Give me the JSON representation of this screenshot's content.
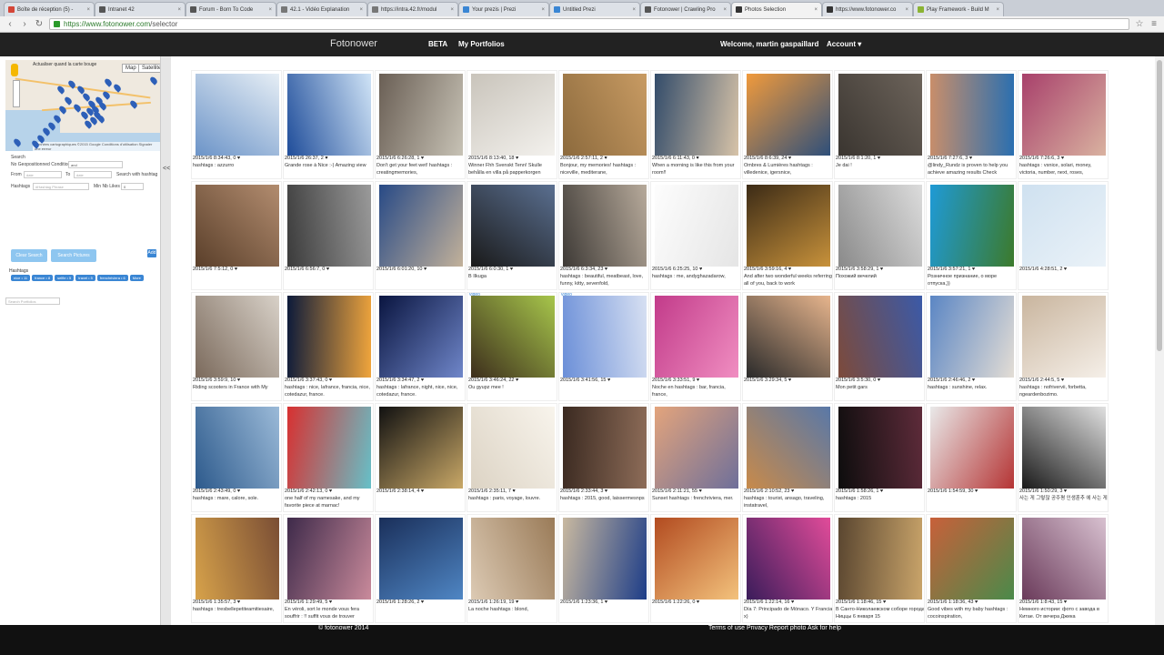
{
  "browser": {
    "tabs": [
      {
        "title": "Boîte de réception (5) -",
        "favicon_color": "#d44638"
      },
      {
        "title": "Intranet 42",
        "favicon_color": "#555555"
      },
      {
        "title": "Forum - Born To Code",
        "favicon_color": "#555555"
      },
      {
        "title": "42.1 - Vidéo Explanation",
        "favicon_color": "#777777"
      },
      {
        "title": "https://intra.42.fr/modul",
        "favicon_color": "#777777"
      },
      {
        "title": "Your prezis | Prezi",
        "favicon_color": "#3a86d4"
      },
      {
        "title": "Untitled Prezi",
        "favicon_color": "#3a86d4"
      },
      {
        "title": "Fotonower | Crawling Pro",
        "favicon_color": "#555555"
      },
      {
        "title": "Photos Selection",
        "favicon_color": "#333333",
        "active": true
      },
      {
        "title": "https://www.fotonower.co",
        "favicon_color": "#333333"
      },
      {
        "title": "Play Framework - Build M",
        "favicon_color": "#8bb333"
      }
    ],
    "url_host": "https://www.fotonower.com",
    "url_path": "/selector",
    "back_icon": "back-arrow-icon",
    "forward_icon": "forward-arrow-icon",
    "reload_icon": "reload-icon",
    "star_icon": "star-icon",
    "menu_icon": "hamburger-menu-icon"
  },
  "header": {
    "logo": "Fotonower",
    "beta": "BETA",
    "portfolios": "My Portfolios",
    "welcome": "Welcome, martin gaspaillard",
    "account": "Account ▾"
  },
  "sidebar": {
    "map": {
      "map_type": "Map",
      "satellite_type": "Satellite",
      "checkbox_label": "Actualiser quand la carte bouge",
      "attribution": "Données cartographiques ©2015 Google  Conditions d'utilisation  Signaler une erreur",
      "colors": {
        "water": "#b7d3ea",
        "land": "#efe9df",
        "pin": "#2d5fb8"
      }
    },
    "search_label": "Search",
    "no_geo_label": "No Geopositionned Condition",
    "no_geo_value": "and",
    "from_label": "From",
    "from_placeholder": "date",
    "to_label": "To",
    "to_placeholder": "date",
    "search_hashtag_label": "Search with hashtag",
    "hashtags_label": "Hashtags",
    "hashtags_placeholder": "#Hashtag Phrase",
    "min_likes_label": "Min Nb Likes",
    "min_likes_value": "0",
    "clear_button": "Clear Search",
    "search_button": "Search Pictures",
    "add_button": "Add",
    "hashtag_section_title": "Hashtags",
    "hashtags": [
      "nice • 11",
      "france • 8",
      "selfie • 5",
      "travel • 5",
      "frenchriviera • 6",
      "More"
    ],
    "portfolio_placeholder": "Search Portfolios",
    "collapse_label": "<<"
  },
  "photos": [
    {
      "meta": "2015/1/6 8:34:43, 0 ♥",
      "caption": "hashtags : azzurro",
      "colors": [
        "#6c94c8",
        "#e6eef5"
      ]
    },
    {
      "meta": "2015/1/6 26:37, 2 ♥",
      "caption": "Grande rose à Nice :-) Amazing view",
      "colors": [
        "#1f4d9a",
        "#cfe3f6"
      ]
    },
    {
      "meta": "2015/1/6 6:26:28, 1 ♥",
      "caption": "Don't get your feet wet! hashtags : creatingmemories,",
      "colors": [
        "#6a5f55",
        "#c7c2b5"
      ]
    },
    {
      "meta": "2015/1/6 8:13:40, 18 ♥",
      "caption": "Winner Fhh Svenskt Tenn! Skulle behålla en villa på papperkorgen",
      "colors": [
        "#c9c4bb",
        "#f3f1ed"
      ]
    },
    {
      "meta": "2015/1/6 2:57:11, 2 ♥",
      "caption": "Bonjour, my memories! hashtags : niceville, mediterane,",
      "colors": [
        "#8c6a3d",
        "#c89b63"
      ]
    },
    {
      "meta": "2015/1/6 6:11:43, 0 ♥",
      "caption": "When a morning is like this from your room!!",
      "colors": [
        "#334c6a",
        "#d7c3a8"
      ]
    },
    {
      "meta": "2015/1/6 8:6:39, 24 ♥",
      "caption": "Ombres & Lumières hashtags : villedenice, igersnice,",
      "colors": [
        "#f09a3c",
        "#2e4f7a"
      ]
    },
    {
      "meta": "2015/1/6 8:1:20, 1 ♥",
      "caption": "Je dai !",
      "colors": [
        "#3a3530",
        "#6d645b"
      ]
    },
    {
      "meta": "2015/1/6 7:27:6, 3 ♥",
      "caption": "@lindy_Rundz is proven to help you achieve amazing results Check",
      "colors": [
        "#c98e6a",
        "#2a6fb0"
      ]
    },
    {
      "meta": "2015/1/6 7:26:6, 3 ♥",
      "caption": "hashtags : vsnice, solari, money, victoria, number, next, roses,",
      "colors": [
        "#a8406b",
        "#d9b2a0"
      ]
    },
    {
      "meta": "2015/1/6 7:5:12, 0 ♥",
      "caption": "",
      "colors": [
        "#5a3f2a",
        "#b28c6f"
      ]
    },
    {
      "meta": "2015/1/6 6:56:7, 0 ♥",
      "caption": "",
      "colors": [
        "#3b3b3b",
        "#9a9a9a"
      ]
    },
    {
      "meta": "2015/1/6 6:01:20, 10 ♥",
      "caption": "",
      "colors": [
        "#284a86",
        "#c2b19a"
      ]
    },
    {
      "meta": "2015/1/6 6:0:30, 1 ♥",
      "caption": "B Ilkuga",
      "colors": [
        "#1a1a1a",
        "#5a6f90"
      ]
    },
    {
      "meta": "2015/1/6 6:3:34, 23 ♥",
      "caption": "hashtags : beautiful, meatbeast, love, funny, kitty, sevenfold,",
      "colors": [
        "#3e3a36",
        "#b7aa9b"
      ]
    },
    {
      "meta": "2015/1/6 6:25:25, 10 ♥",
      "caption": "hashtags : me, andyghazadarow,",
      "colors": [
        "#fdfdfd",
        "#e5e5e5"
      ]
    },
    {
      "meta": "2015/1/6 3:59:16, 4 ♥",
      "caption": "And after two wonderful weeks referring all of you, back to work",
      "colors": [
        "#3c2b16",
        "#c8923b"
      ]
    },
    {
      "meta": "2015/1/6 3:58:29, 1 ♥",
      "caption": "Похожий вечелий",
      "colors": [
        "#8a8a8a",
        "#dcdcdc"
      ]
    },
    {
      "meta": "2015/1/6 3:57:21, 1 ♥",
      "caption": "Розничное признание, о море отпуска,))",
      "colors": [
        "#1f9ad6",
        "#3c7a2b"
      ]
    },
    {
      "meta": "2015/1/6 4:28:51, 2 ♥",
      "caption": "",
      "colors": [
        "#cfe1f0",
        "#eaf2f8"
      ]
    },
    {
      "meta": "2015/1/6 3:59:9, 10 ♥",
      "caption": "Riding scooters in France with My",
      "colors": [
        "#7b6a5c",
        "#d8d1c8"
      ]
    },
    {
      "meta": "2015/1/6 3:37:43, 0 ♥",
      "caption": "hashtags : nice, lafrance, francia, nice, cotedazur, france.",
      "colors": [
        "#0c1a3a",
        "#f0a53c"
      ]
    },
    {
      "meta": "2015/1/6 3:34:47, 2 ♥",
      "caption": "hashtags : lafrance, night, nice, nice, cotedazur, france.",
      "colors": [
        "#0a1540",
        "#6f86c9"
      ]
    },
    {
      "meta": "2015/1/6 3:46:24, 22 ♥",
      "caption": "Ou gyupz mee !",
      "colors": [
        "#3d2e1c",
        "#a7c64b"
      ],
      "video": "video"
    },
    {
      "meta": "2015/1/6 3:41:56, 15 ♥",
      "caption": "",
      "colors": [
        "#6b8fd8",
        "#d7e0f2"
      ],
      "video": "video"
    },
    {
      "meta": "2015/1/6 3:33:51, 9 ♥",
      "caption": "Noche en hashtags : bar, francia, france,",
      "colors": [
        "#c23b8a",
        "#f08ec1"
      ]
    },
    {
      "meta": "2015/1/6 3:29:34, 5 ♥",
      "caption": "",
      "colors": [
        "#2a2a2a",
        "#e7b58d"
      ]
    },
    {
      "meta": "2015/1/6 3:5:30, 0 ♥",
      "caption": "Mon petit gars",
      "colors": [
        "#7d4a3a",
        "#3b5aa8"
      ]
    },
    {
      "meta": "2015/1/6 2:46:46, 2 ♥",
      "caption": "hashtags : sunshine, relax.",
      "colors": [
        "#5b86c4",
        "#e3ddd5"
      ]
    },
    {
      "meta": "2015/1/6 2:44:5, 5 ♥",
      "caption": "hashtags : nofrivervii, forbetta, ngeardenbozimo.",
      "colors": [
        "#c9b59e",
        "#f5efe8"
      ]
    },
    {
      "meta": "2015/1/6 2:43:49, 0 ♥",
      "caption": "hashtags : mare, calore, sole.",
      "colors": [
        "#2d5a8c",
        "#9bbad8"
      ]
    },
    {
      "meta": "2015/1/6 2:42:13, 0 ♥",
      "caption": "one half of my namesake, and my favorite piece at marnac!",
      "colors": [
        "#d83030",
        "#66c0c8"
      ]
    },
    {
      "meta": "2015/1/6 2:38:14, 4 ♥",
      "caption": "",
      "colors": [
        "#111111",
        "#c9a867"
      ]
    },
    {
      "meta": "2015/1/6 2:35:11, 7 ♥",
      "caption": "hashtags : paris, voyage, louvre.",
      "colors": [
        "#dcd3c4",
        "#f8f4ec"
      ]
    },
    {
      "meta": "2015/1/6 2:33:44, 3 ♥",
      "caption": "hashtags : 2015, good, laissermesnps",
      "colors": [
        "#3b2a21",
        "#8d6c58"
      ]
    },
    {
      "meta": "2015/1/6 2:11:21, 55 ♥",
      "caption": "Sunset hashtags : frenchriviera, mer.",
      "colors": [
        "#e3a47c",
        "#6e6f9a"
      ]
    },
    {
      "meta": "2015/1/6 2:10:52, 23 ♥",
      "caption": "hashtags : tourist, ansago, traveling, instatravel,",
      "colors": [
        "#c88a4a",
        "#5978a8"
      ]
    },
    {
      "meta": "2015/1/6 1:58:26, 1 ♥",
      "caption": "hashtags : 2015",
      "colors": [
        "#0d0d0d",
        "#5e2b3a"
      ]
    },
    {
      "meta": "2015/1/6 1:54:59, 30 ♥",
      "caption": "",
      "colors": [
        "#e9e9e9",
        "#b53434"
      ]
    },
    {
      "meta": "2015/1/6 1:50:29, 3 ♥",
      "caption": "사는 게 그렇잖 공주평 인생훈추 에 사는 게",
      "colors": [
        "#1a1a1a",
        "#e0e0e0"
      ]
    },
    {
      "meta": "2015/1/6 1:35:57, 3 ♥",
      "caption": "hashtags : tresbellepetiteamitiesaire,",
      "colors": [
        "#d7a24a",
        "#7a4e35"
      ]
    },
    {
      "meta": "2015/1/6 1:29:49, 5 ♥",
      "caption": "En véroli, sort le monde vous fera souffrir : !! suffit vous de trouver",
      "colors": [
        "#3e2a4a",
        "#c98a9b"
      ]
    },
    {
      "meta": "2015/1/6 1:28:26, 2 ♥",
      "caption": "",
      "colors": [
        "#1a2f5a",
        "#4f86c4"
      ]
    },
    {
      "meta": "2015/1/6 1:26:19, 19 ♥",
      "caption": "La noche hashtags : blond,",
      "colors": [
        "#dccab4",
        "#9a7b58"
      ]
    },
    {
      "meta": "2015/1/6 1:23:36, 1 ♥",
      "caption": "",
      "colors": [
        "#c9b9a0",
        "#1d3d88"
      ]
    },
    {
      "meta": "2015/1/6 1:22:26, 0 ♥",
      "caption": "",
      "colors": [
        "#b24b20",
        "#f3c27c"
      ]
    },
    {
      "meta": "2015/1/6 1:22:14, 16 ♥",
      "caption": "Día 7: Principado de Mónaco. Y Francia x)",
      "colors": [
        "#3a1c5a",
        "#e24c9a"
      ]
    },
    {
      "meta": "2015/1/6 1:18:46, 15 ♥",
      "caption": "В Санто-Николаевском соборе города Ниццы 6 января 15",
      "colors": [
        "#5a4630",
        "#c9a46a"
      ]
    },
    {
      "meta": "2015/1/6 1:18:36, 43 ♥",
      "caption": "Good vibes with my baby hashtags : cocoinspiration,",
      "colors": [
        "#c8603a",
        "#4a8a4a"
      ]
    },
    {
      "meta": "2015/1/6 1:8:43, 15 ♥",
      "caption": "Немного истории: фото с завода в Китае. От вечера Джека",
      "colors": [
        "#6a3a5a",
        "#d8c1d0"
      ]
    }
  ],
  "footer": {
    "copyright": "© fotonower 2014",
    "links": "Terms of use  Privacy Report photo  Ask for help"
  }
}
